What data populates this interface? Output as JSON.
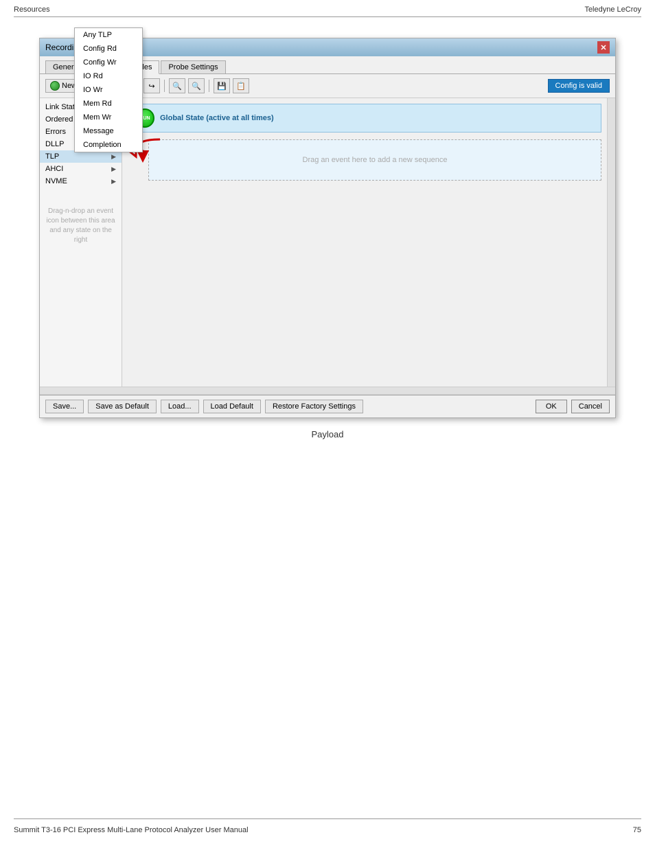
{
  "header": {
    "left": "Resources",
    "right": "Teledyne LeCroy"
  },
  "dialog": {
    "title": "Recording Options",
    "tabs": [
      {
        "label": "General",
        "active": false
      },
      {
        "label": "Recording Rules",
        "active": true
      },
      {
        "label": "Probe Settings",
        "active": false
      }
    ],
    "toolbar": {
      "new_event_label": "New event",
      "config_valid_label": "Config is valid"
    },
    "event_list": [
      {
        "label": "Link State",
        "has_arrow": true
      },
      {
        "label": "Ordered Set",
        "has_arrow": true
      },
      {
        "label": "Errors",
        "has_arrow": true
      },
      {
        "label": "DLLP",
        "has_arrow": true
      },
      {
        "label": "TLP",
        "has_arrow": true,
        "highlighted": true
      },
      {
        "label": "AHCI",
        "has_arrow": true
      },
      {
        "label": "NVME",
        "has_arrow": true
      }
    ],
    "tlp_submenu": [
      "Any TLP",
      "Config Rd",
      "Config Wr",
      "IO Rd",
      "IO Wr",
      "Mem Rd",
      "Mem Wr",
      "Message",
      "Completion"
    ],
    "global_state_label": "Global State (active at all times)",
    "run_label": "RUN",
    "sequence_drop_hint": "Drag an event here to add a new sequence",
    "drag_hint": "Drag-n-drop an event icon between this area and any state on the right",
    "footer": {
      "save_label": "Save...",
      "save_default_label": "Save as Default",
      "load_label": "Load...",
      "load_default_label": "Load Default",
      "restore_label": "Restore Factory Settings",
      "ok_label": "OK",
      "cancel_label": "Cancel"
    }
  },
  "caption": "Payload",
  "footer": {
    "left": "Summit T3-16 PCI Express Multi-Lane Protocol Analyzer User Manual",
    "right": "75"
  }
}
